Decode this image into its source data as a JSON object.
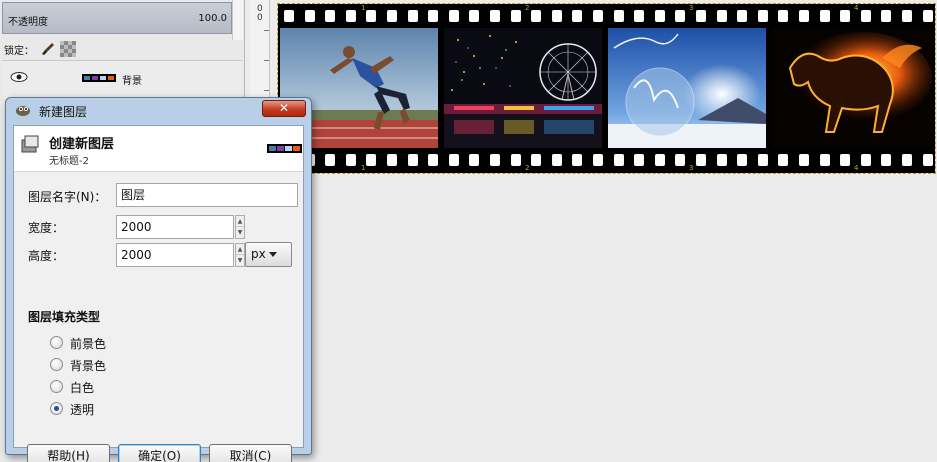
{
  "layers_panel": {
    "opacity_label": "不透明度",
    "opacity_value": "100.0",
    "lock_label": "锁定：",
    "layer_name": "背景"
  },
  "ruler": {
    "digits": "0",
    "digits2": "0"
  },
  "filmstrip": {
    "frame_numbers": [
      "1",
      "2",
      "3",
      "4"
    ]
  },
  "dialog": {
    "title": "新建图层",
    "close_label": "✕",
    "heading": "创建新图层",
    "subtitle": "无标题-2",
    "layer_name_label": "图层名字(N)：",
    "layer_name_value": "图层",
    "width_label": "宽度：",
    "width_value": "2000",
    "height_label": "高度：",
    "height_value": "2000",
    "unit_value": "px",
    "fill_type_heading": "图层填充类型",
    "fill_options": [
      {
        "label": "前景色",
        "checked": false
      },
      {
        "label": "背景色",
        "checked": false
      },
      {
        "label": "白色",
        "checked": false
      },
      {
        "label": "透明",
        "checked": true
      }
    ],
    "buttons": {
      "help": "帮助(H)",
      "ok": "确定(O)",
      "cancel": "取消(C)"
    }
  },
  "colors": {
    "dialog_frame": "#b8cfe7",
    "close_button": "#c43c20",
    "film_border": "#000000",
    "selection_outline": "#c0a020"
  }
}
